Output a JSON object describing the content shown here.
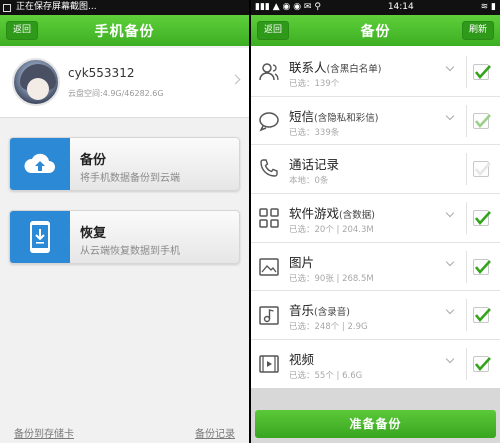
{
  "left": {
    "status_text": "正在保存屏幕截图...",
    "title": "手机备份",
    "back_label": "返回",
    "profile": {
      "username": "cyk553312",
      "storage": "云盘空间:4.9G/46282.6G"
    },
    "cards": {
      "backup": {
        "title": "备份",
        "desc": "将手机数据备份到云端"
      },
      "restore": {
        "title": "恢复",
        "desc": "从云端恢复数据到手机"
      }
    },
    "links": {
      "to_sd": "备份到存储卡",
      "records": "备份记录"
    }
  },
  "right": {
    "status_time": "14:14",
    "title": "备份",
    "back_label": "返回",
    "refresh_label": "刷新",
    "items": [
      {
        "title": "联系人",
        "note": "(含黑白名单)",
        "sub": "已选：139个",
        "icon": "contacts-icon",
        "checked": true
      },
      {
        "title": "短信",
        "note": "(含隐私和彩信)",
        "sub": "已选：339条",
        "icon": "sms-icon",
        "checked": true
      },
      {
        "title": "通话记录",
        "note": "",
        "sub": "本地：0条",
        "icon": "phone-icon",
        "checked": false
      },
      {
        "title": "软件游戏",
        "note": "(含数据)",
        "sub": "已选：20个 | 204.3M",
        "icon": "apps-icon",
        "checked": true
      },
      {
        "title": "图片",
        "note": "",
        "sub": "已选：90张 | 268.5M",
        "icon": "image-icon",
        "checked": true
      },
      {
        "title": "音乐",
        "note": "(含录音)",
        "sub": "已选：248个 | 2.9G",
        "icon": "music-icon",
        "checked": true
      },
      {
        "title": "视频",
        "note": "",
        "sub": "已选：55个 | 6.6G",
        "icon": "video-icon",
        "checked": true
      }
    ],
    "primary_button": "准备备份"
  },
  "colors": {
    "green": "#3cae22",
    "blue": "#2b89d6",
    "check": "#34a41c"
  }
}
